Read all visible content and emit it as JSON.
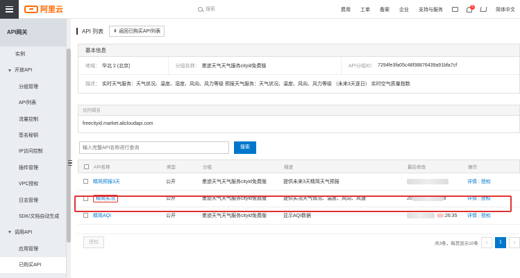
{
  "topbar": {
    "brand": "阿里云",
    "search_placeholder": "搜索",
    "nav": [
      "费用",
      "工单",
      "备案",
      "企业",
      "支持与服务"
    ],
    "badge_count": "5",
    "language": "简体中文"
  },
  "sidebar": {
    "title": "API网关",
    "items": [
      {
        "label": "实例",
        "type": "item"
      },
      {
        "label": "开放API",
        "type": "group"
      },
      {
        "label": "分组管理",
        "type": "item"
      },
      {
        "label": "API列表",
        "type": "item"
      },
      {
        "label": "流量控制",
        "type": "item"
      },
      {
        "label": "签名秘钥",
        "type": "item"
      },
      {
        "label": "IP访问控制",
        "type": "item"
      },
      {
        "label": "插件管理",
        "type": "item"
      },
      {
        "label": "VPC授权",
        "type": "item"
      },
      {
        "label": "日志管理",
        "type": "item"
      },
      {
        "label": "SDK/文档自动生成",
        "type": "item"
      },
      {
        "label": "调用API",
        "type": "group"
      },
      {
        "label": "应用管理",
        "type": "item"
      },
      {
        "label": "已购买API",
        "type": "item"
      }
    ]
  },
  "header": {
    "title": "API 列表",
    "back_label": "返回已购买API列表"
  },
  "basic_info": {
    "title": "基本信息",
    "region_label": "地域：",
    "region_value": "华北 2 (北京)",
    "group_label": "分组名称：",
    "group_value": "墨迹天气天气服务cityid免费版",
    "groupid_label": "API分组ID：",
    "groupid_value": "7294fe3fa05c48f38876439a91bfa7cf",
    "desc_label": "描述：",
    "desc_value": "实时天气服务：天气状况、温度、湿度、风向、风力等级 预报天气服务：天气状况、温度、风向、风力等级 （未来3天逐日） 实时空气质量指数"
  },
  "domain": {
    "label": "访问域名",
    "value": "freecityid.market.alicloudapi.com"
  },
  "query": {
    "placeholder": "输入完整API名称进行查询",
    "button": "搜索"
  },
  "table": {
    "headers": [
      "API名称",
      "类型",
      "分组",
      "描述",
      "最后修改",
      "操作"
    ],
    "rows": [
      {
        "name": "精简预报3天",
        "type": "公开",
        "group": "墨迹天气天气服务cityid免费版",
        "desc": "提供未来3天精简天气预报",
        "time_suffix": "",
        "op_detail": "详情",
        "op_auth": "授权"
      },
      {
        "name": "精简实况",
        "type": "公开",
        "group": "墨迹天气天气服务cityid免费版",
        "desc": "提供实况天气情况、温度、风向、风速",
        "time_prefix": "20",
        "time_suffix": "9",
        "op_detail": "详情",
        "op_auth": "授权"
      },
      {
        "name": "精简AQI",
        "type": "公开",
        "group": "墨迹天气天气服务cityid免费版",
        "desc": "显示AQI数据",
        "time_suffix": ":26:35",
        "op_detail": "详情",
        "op_auth": "授权"
      }
    ]
  },
  "footer": {
    "auth_button": "授权",
    "paging_text": "共3条，每页显示10条",
    "prev": "‹",
    "current_page": "1",
    "next": "›"
  },
  "colors": {
    "brand": "#ff6a00",
    "primary": "#0077cc",
    "highlight": "#e03131"
  }
}
